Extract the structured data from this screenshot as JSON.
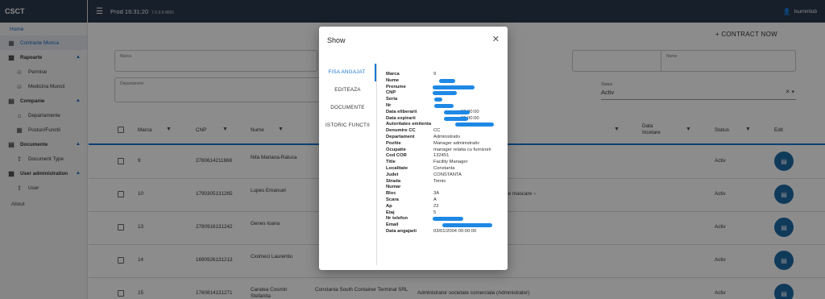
{
  "app": {
    "brand": "CSCT",
    "env_title": "Prod 16:31:20",
    "env_sub": "7.0.9.5-8601",
    "user": "lsurnmlub"
  },
  "sidebar": {
    "home": "Home",
    "items": [
      {
        "label": "Contracte Munca",
        "type": "item",
        "icon": "contract-icon",
        "active": true
      },
      {
        "label": "Rapoarte",
        "type": "group",
        "icon": "chart-icon"
      },
      {
        "label": "Permise",
        "type": "sub",
        "icon": "person-icon"
      },
      {
        "label": "Medicina Muncii",
        "type": "sub",
        "icon": "person-icon"
      },
      {
        "label": "Companie",
        "type": "group",
        "icon": "briefcase-icon"
      },
      {
        "label": "Departamente",
        "type": "sub",
        "icon": "home-icon"
      },
      {
        "label": "Posturi/Functii",
        "type": "sub",
        "icon": "clipboard-icon"
      },
      {
        "label": "Documente",
        "type": "group",
        "icon": "document-icon"
      },
      {
        "label": "Document Type",
        "type": "sub",
        "icon": "upload-icon"
      },
      {
        "label": "User administration",
        "type": "group",
        "icon": "users-icon"
      },
      {
        "label": "User",
        "type": "sub",
        "icon": "upload-icon"
      }
    ],
    "about": "About"
  },
  "main": {
    "add_button": "+ CONTRACT NOW",
    "filters": {
      "marca_label": "Marca",
      "nume_label": "Nume",
      "departament_label": "Departament",
      "status_label": "Status",
      "status_value": "Activ"
    },
    "columns": [
      "Marca",
      "CNP",
      "Nume",
      "Data Incetare",
      "Status",
      "Edit"
    ],
    "rows": [
      {
        "marca": "9",
        "cnp": "2780614211668",
        "nume": "Nita Mariana-Raluca",
        "companie": "",
        "functie": "r)",
        "status": "Activ"
      },
      {
        "marca": "10",
        "cnp": "1790305131265",
        "nume": "Lupes Emanuel",
        "companie": "",
        "functie": "orwarding coordinator (Operator circulatie mascare ~",
        "status": "Activ"
      },
      {
        "marca": "13",
        "cnp": "2780916131242",
        "nume": "Genes Ioana",
        "companie": "",
        "functie": "upervisor)",
        "status": "Activ"
      },
      {
        "marca": "14",
        "cnp": "1690926131213",
        "nume": "Ciolmeci Laurentiu",
        "companie": "",
        "functie": "",
        "status": "Activ"
      },
      {
        "marca": "15",
        "cnp": "1760814131271",
        "nume": "Caratea Cosmin Stefanita",
        "companie": "Constanta South Container Terminal SRL",
        "functie": "Administrator societate comerciala (Administrator)",
        "status": "Activ"
      }
    ]
  },
  "modal": {
    "title": "Show",
    "tabs": [
      "FISA ANGAJAT",
      "EDITEAZA",
      "DOCUMENTE",
      "ISTORIC FUNCTII"
    ],
    "fields": [
      {
        "k": "Marca",
        "v": "9"
      },
      {
        "k": "Nume",
        "v": ""
      },
      {
        "k": "Prenume",
        "v": ""
      },
      {
        "k": "CNP",
        "v": ""
      },
      {
        "k": "Seria",
        "v": ""
      },
      {
        "k": "Nr",
        "v": ""
      },
      {
        "k": "Data eliberarii",
        "v": "00:00:00"
      },
      {
        "k": "Data expirarii",
        "v": "00:00:00"
      },
      {
        "k": "Autoritates emitenta",
        "v": ""
      },
      {
        "k": "Denumire CC",
        "v": "CC"
      },
      {
        "k": "Departament",
        "v": "Administrativ"
      },
      {
        "k": "Pozitie",
        "v": "Manager administrativ"
      },
      {
        "k": "Ocupatie",
        "v": "manager relatia cu furnizorii"
      },
      {
        "k": "Cod COR",
        "v": "132451"
      },
      {
        "k": "Title",
        "v": "Facility Manager"
      },
      {
        "k": "Localitate",
        "v": "Constanta"
      },
      {
        "k": "Judet",
        "v": "CONSTANTA"
      },
      {
        "k": "Strada",
        "v": "Tomis"
      },
      {
        "k": "Numar",
        "v": ""
      },
      {
        "k": "Bloc",
        "v": "3A"
      },
      {
        "k": "Scara",
        "v": "A"
      },
      {
        "k": "Ap",
        "v": "23"
      },
      {
        "k": "Etaj",
        "v": "5"
      },
      {
        "k": "Nr telefon",
        "v": ""
      },
      {
        "k": "Email",
        "v": ""
      },
      {
        "k": "Data angajarii",
        "v": "03/01/2004 00:00:00"
      }
    ]
  },
  "colors": {
    "topbar": "#2b3a4e",
    "accent": "#1976d2",
    "fab": "#1e6aa5"
  }
}
